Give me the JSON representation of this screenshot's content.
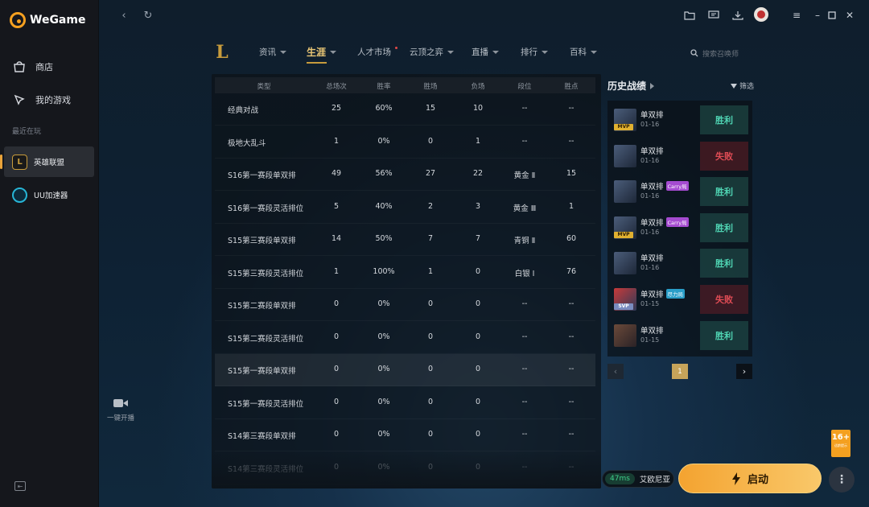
{
  "app": {
    "name": "WeGame"
  },
  "sidebar": {
    "items": [
      {
        "label": "商店",
        "icon": "store-icon"
      },
      {
        "label": "我的游戏",
        "icon": "gamepad-icon"
      }
    ],
    "recent_label": "最近在玩",
    "games": [
      {
        "label": "英雄联盟",
        "icon": "lol-icon",
        "active": true
      },
      {
        "label": "UU加速器",
        "icon": "uu-icon",
        "active": false
      }
    ]
  },
  "game_nav": {
    "logo": "L",
    "tabs": [
      {
        "label": "资讯"
      },
      {
        "label": "生涯",
        "active": true
      },
      {
        "label": "人才市场"
      },
      {
        "label": "云顶之弈"
      },
      {
        "label": "直播"
      },
      {
        "label": "排行"
      },
      {
        "label": "百科"
      }
    ],
    "search_placeholder": "搜索召唤师"
  },
  "stats_table": {
    "headers": [
      "类型",
      "总场次",
      "胜率",
      "胜场",
      "负场",
      "段位",
      "胜点"
    ],
    "rows": [
      [
        "经典对战",
        "25",
        "60%",
        "15",
        "10",
        "--",
        "--"
      ],
      [
        "极地大乱斗",
        "1",
        "0%",
        "0",
        "1",
        "--",
        "--"
      ],
      [
        "S16第一赛段单双排",
        "49",
        "56%",
        "27",
        "22",
        "黄金 Ⅱ",
        "15"
      ],
      [
        "S16第一赛段灵活排位",
        "5",
        "40%",
        "2",
        "3",
        "黄金 Ⅲ",
        "1"
      ],
      [
        "S15第三赛段单双排",
        "14",
        "50%",
        "7",
        "7",
        "青铜 Ⅱ",
        "60"
      ],
      [
        "S15第三赛段灵活排位",
        "1",
        "100%",
        "1",
        "0",
        "白银 Ⅰ",
        "76"
      ],
      [
        "S15第二赛段单双排",
        "0",
        "0%",
        "0",
        "0",
        "--",
        "--"
      ],
      [
        "S15第二赛段灵活排位",
        "0",
        "0%",
        "0",
        "0",
        "--",
        "--"
      ],
      [
        "S15第一赛段单双排",
        "0",
        "0%",
        "0",
        "0",
        "--",
        "--"
      ],
      [
        "S15第一赛段灵活排位",
        "0",
        "0%",
        "0",
        "0",
        "--",
        "--"
      ],
      [
        "S14第三赛段单双排",
        "0",
        "0%",
        "0",
        "0",
        "--",
        "--"
      ],
      [
        "S14第三赛段灵活排位",
        "0",
        "0%",
        "0",
        "0",
        "--",
        "--"
      ]
    ]
  },
  "history": {
    "title": "历史战绩",
    "filter_label": "筛选",
    "matches": [
      {
        "mode": "单双排",
        "date": "01-16",
        "badge": "MVP",
        "tag": "",
        "result": "胜利",
        "win": true
      },
      {
        "mode": "单双排",
        "date": "01-16",
        "badge": "",
        "tag": "",
        "result": "失败",
        "win": false
      },
      {
        "mode": "单双排",
        "date": "01-16",
        "badge": "",
        "tag": "Carry局",
        "result": "胜利",
        "win": true
      },
      {
        "mode": "单双排",
        "date": "01-16",
        "badge": "MVP",
        "tag": "Carry局",
        "result": "胜利",
        "win": true
      },
      {
        "mode": "单双排",
        "date": "01-16",
        "badge": "",
        "tag": "",
        "result": "胜利",
        "win": true
      },
      {
        "mode": "单双排",
        "date": "01-15",
        "badge": "SVP",
        "tag": "尽力局",
        "result": "失败",
        "win": false
      },
      {
        "mode": "单双排",
        "date": "01-15",
        "badge": "",
        "tag": "",
        "result": "胜利",
        "win": true
      }
    ],
    "page": "1"
  },
  "bottom": {
    "broadcast_label": "一键开播",
    "ping": "47ms",
    "server": "艾欧尼亚",
    "launch_label": "启动",
    "age_rating": "16+",
    "age_sub": "适龄提示"
  }
}
